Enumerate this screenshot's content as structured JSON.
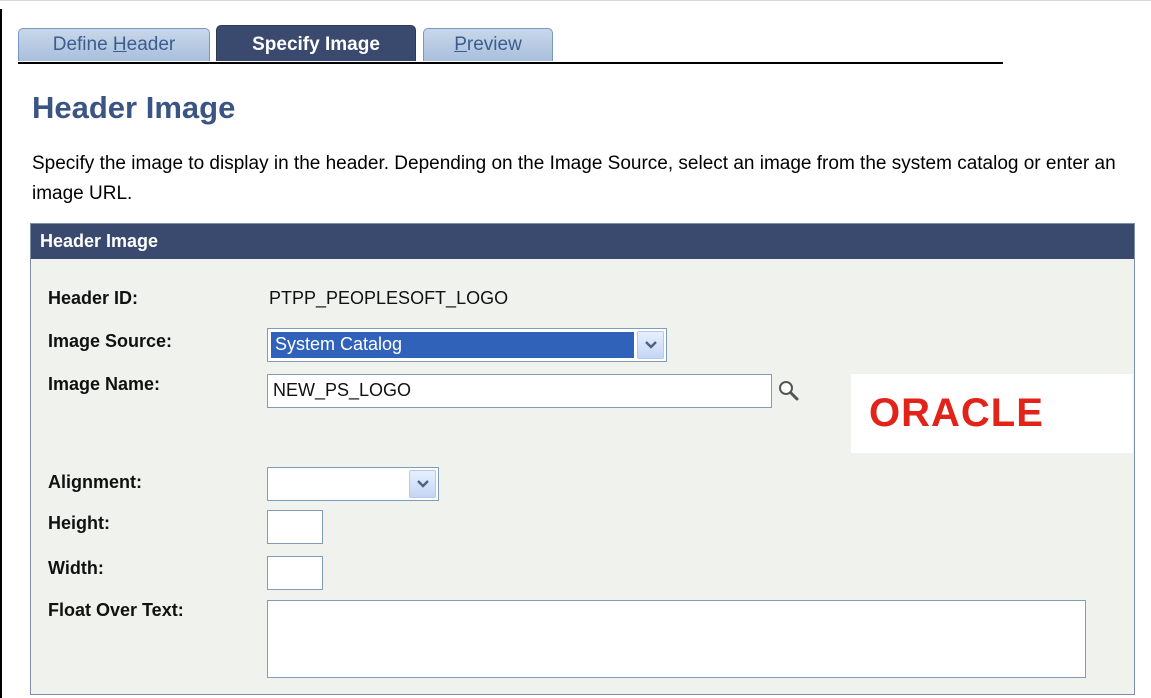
{
  "tabs": [
    {
      "label_pre": "Define ",
      "label_underline": "H",
      "label_post": "eader"
    },
    {
      "label": "Specify Image"
    },
    {
      "label_pre": "",
      "label_underline": "P",
      "label_post": "review"
    }
  ],
  "page": {
    "title": "Header Image",
    "instructions": "Specify the image to display in the header. Depending on the Image Source, select an image from the system catalog or enter an image URL."
  },
  "group": {
    "title": "Header Image",
    "header_id_label": "Header ID:",
    "header_id_value": "PTPP_PEOPLESOFT_LOGO",
    "image_source_label": "Image Source:",
    "image_source_value": "System Catalog",
    "image_name_label": "Image Name:",
    "image_name_value": "NEW_PS_LOGO",
    "alignment_label": "Alignment:",
    "alignment_value": "",
    "height_label": "Height:",
    "height_value": "",
    "width_label": "Width:",
    "width_value": "",
    "float_over_text_label": "Float Over Text:",
    "float_over_text_value": ""
  },
  "logo": {
    "text": "ORACLE",
    "color": "#e2231a"
  },
  "icons": {
    "lookup": "magnifier-icon",
    "dropdown": "chevron-down-icon"
  }
}
